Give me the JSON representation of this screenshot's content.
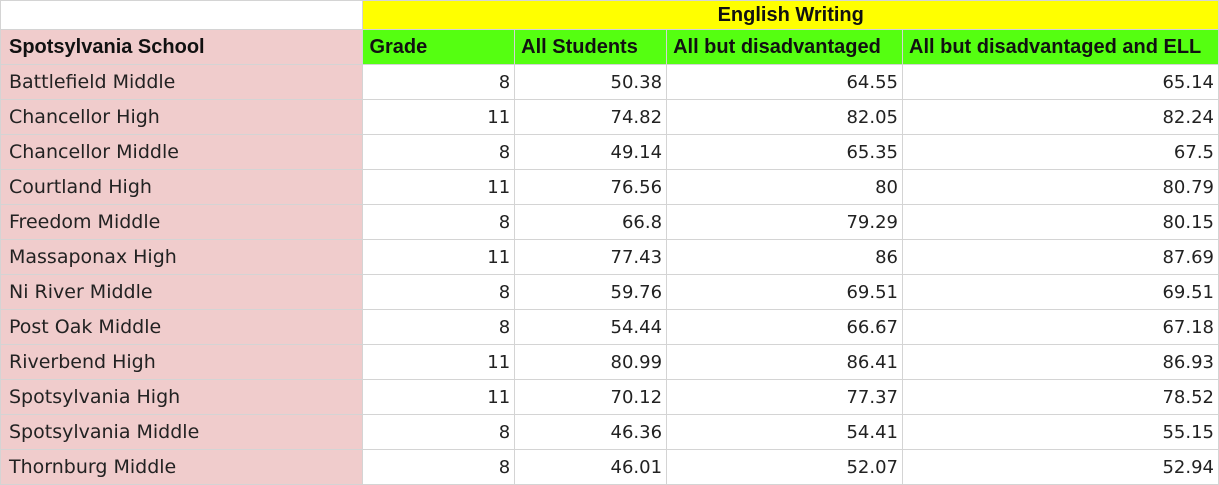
{
  "colors": {
    "school_column_bg": "#f0cccc",
    "header_row_bg": "#55ff11",
    "title_bg": "#ffff00",
    "gridline": "#d4d4d4"
  },
  "sheet": {
    "group_title": "English Writing",
    "headers": {
      "school": "Spotsylvania School",
      "grade": "Grade",
      "all_students": "All Students",
      "all_but_disadvantaged": "All but disadvantaged",
      "all_but_disadvantaged_ell": "All but disadvantaged and ELL"
    },
    "rows": [
      {
        "school": "Battlefield Middle",
        "grade": "8",
        "all_students": "50.38",
        "all_but_disadvantaged": "64.55",
        "all_but_disadvantaged_ell": "65.14"
      },
      {
        "school": "Chancellor High",
        "grade": "11",
        "all_students": "74.82",
        "all_but_disadvantaged": "82.05",
        "all_but_disadvantaged_ell": "82.24"
      },
      {
        "school": "Chancellor Middle",
        "grade": "8",
        "all_students": "49.14",
        "all_but_disadvantaged": "65.35",
        "all_but_disadvantaged_ell": "67.5"
      },
      {
        "school": "Courtland High",
        "grade": "11",
        "all_students": "76.56",
        "all_but_disadvantaged": "80",
        "all_but_disadvantaged_ell": "80.79"
      },
      {
        "school": "Freedom Middle",
        "grade": "8",
        "all_students": "66.8",
        "all_but_disadvantaged": "79.29",
        "all_but_disadvantaged_ell": "80.15"
      },
      {
        "school": "Massaponax High",
        "grade": "11",
        "all_students": "77.43",
        "all_but_disadvantaged": "86",
        "all_but_disadvantaged_ell": "87.69"
      },
      {
        "school": "Ni River Middle",
        "grade": "8",
        "all_students": "59.76",
        "all_but_disadvantaged": "69.51",
        "all_but_disadvantaged_ell": "69.51"
      },
      {
        "school": "Post Oak Middle",
        "grade": "8",
        "all_students": "54.44",
        "all_but_disadvantaged": "66.67",
        "all_but_disadvantaged_ell": "67.18"
      },
      {
        "school": "Riverbend High",
        "grade": "11",
        "all_students": "80.99",
        "all_but_disadvantaged": "86.41",
        "all_but_disadvantaged_ell": "86.93"
      },
      {
        "school": "Spotsylvania High",
        "grade": "11",
        "all_students": "70.12",
        "all_but_disadvantaged": "77.37",
        "all_but_disadvantaged_ell": "78.52"
      },
      {
        "school": "Spotsylvania Middle",
        "grade": "8",
        "all_students": "46.36",
        "all_but_disadvantaged": "54.41",
        "all_but_disadvantaged_ell": "55.15"
      },
      {
        "school": "Thornburg Middle",
        "grade": "8",
        "all_students": "46.01",
        "all_but_disadvantaged": "52.07",
        "all_but_disadvantaged_ell": "52.94"
      }
    ]
  }
}
